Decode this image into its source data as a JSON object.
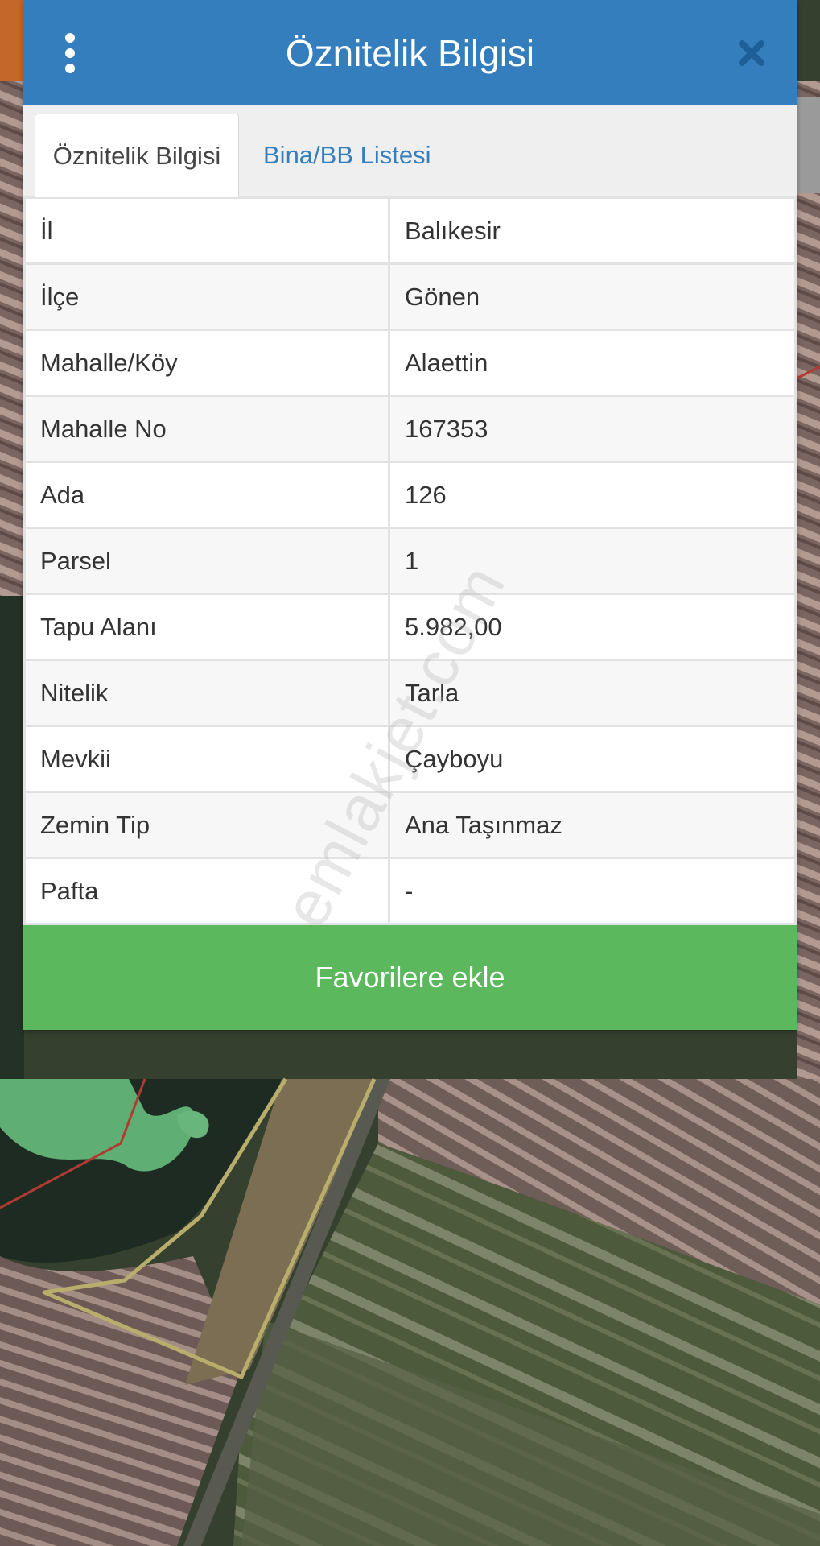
{
  "header": {
    "title": "Öznitelik Bilgisi"
  },
  "tabs": [
    {
      "label": "Öznitelik Bilgisi",
      "active": true
    },
    {
      "label": "Bina/BB Listesi",
      "active": false
    }
  ],
  "attributes": [
    {
      "key": "İl",
      "value": "Balıkesir"
    },
    {
      "key": "İlçe",
      "value": "Gönen"
    },
    {
      "key": "Mahalle/Köy",
      "value": "Alaettin"
    },
    {
      "key": "Mahalle No",
      "value": "167353"
    },
    {
      "key": "Ada",
      "value": "126"
    },
    {
      "key": "Parsel",
      "value": "1"
    },
    {
      "key": "Tapu Alanı",
      "value": "5.982,00"
    },
    {
      "key": "Nitelik",
      "value": "Tarla"
    },
    {
      "key": "Mevkii",
      "value": "Çayboyu"
    },
    {
      "key": "Zemin Tip",
      "value": "Ana Taşınmaz"
    },
    {
      "key": "Pafta",
      "value": "-"
    }
  ],
  "actions": {
    "favorite_label": "Favorilere ekle"
  },
  "watermark": "emlakjet.com",
  "icons": {
    "menu": "vertical-dots-icon",
    "close": "close-icon"
  },
  "colors": {
    "header": "#357ebd",
    "tab_link": "#357ebd",
    "favorite_button": "#5cb85c"
  }
}
